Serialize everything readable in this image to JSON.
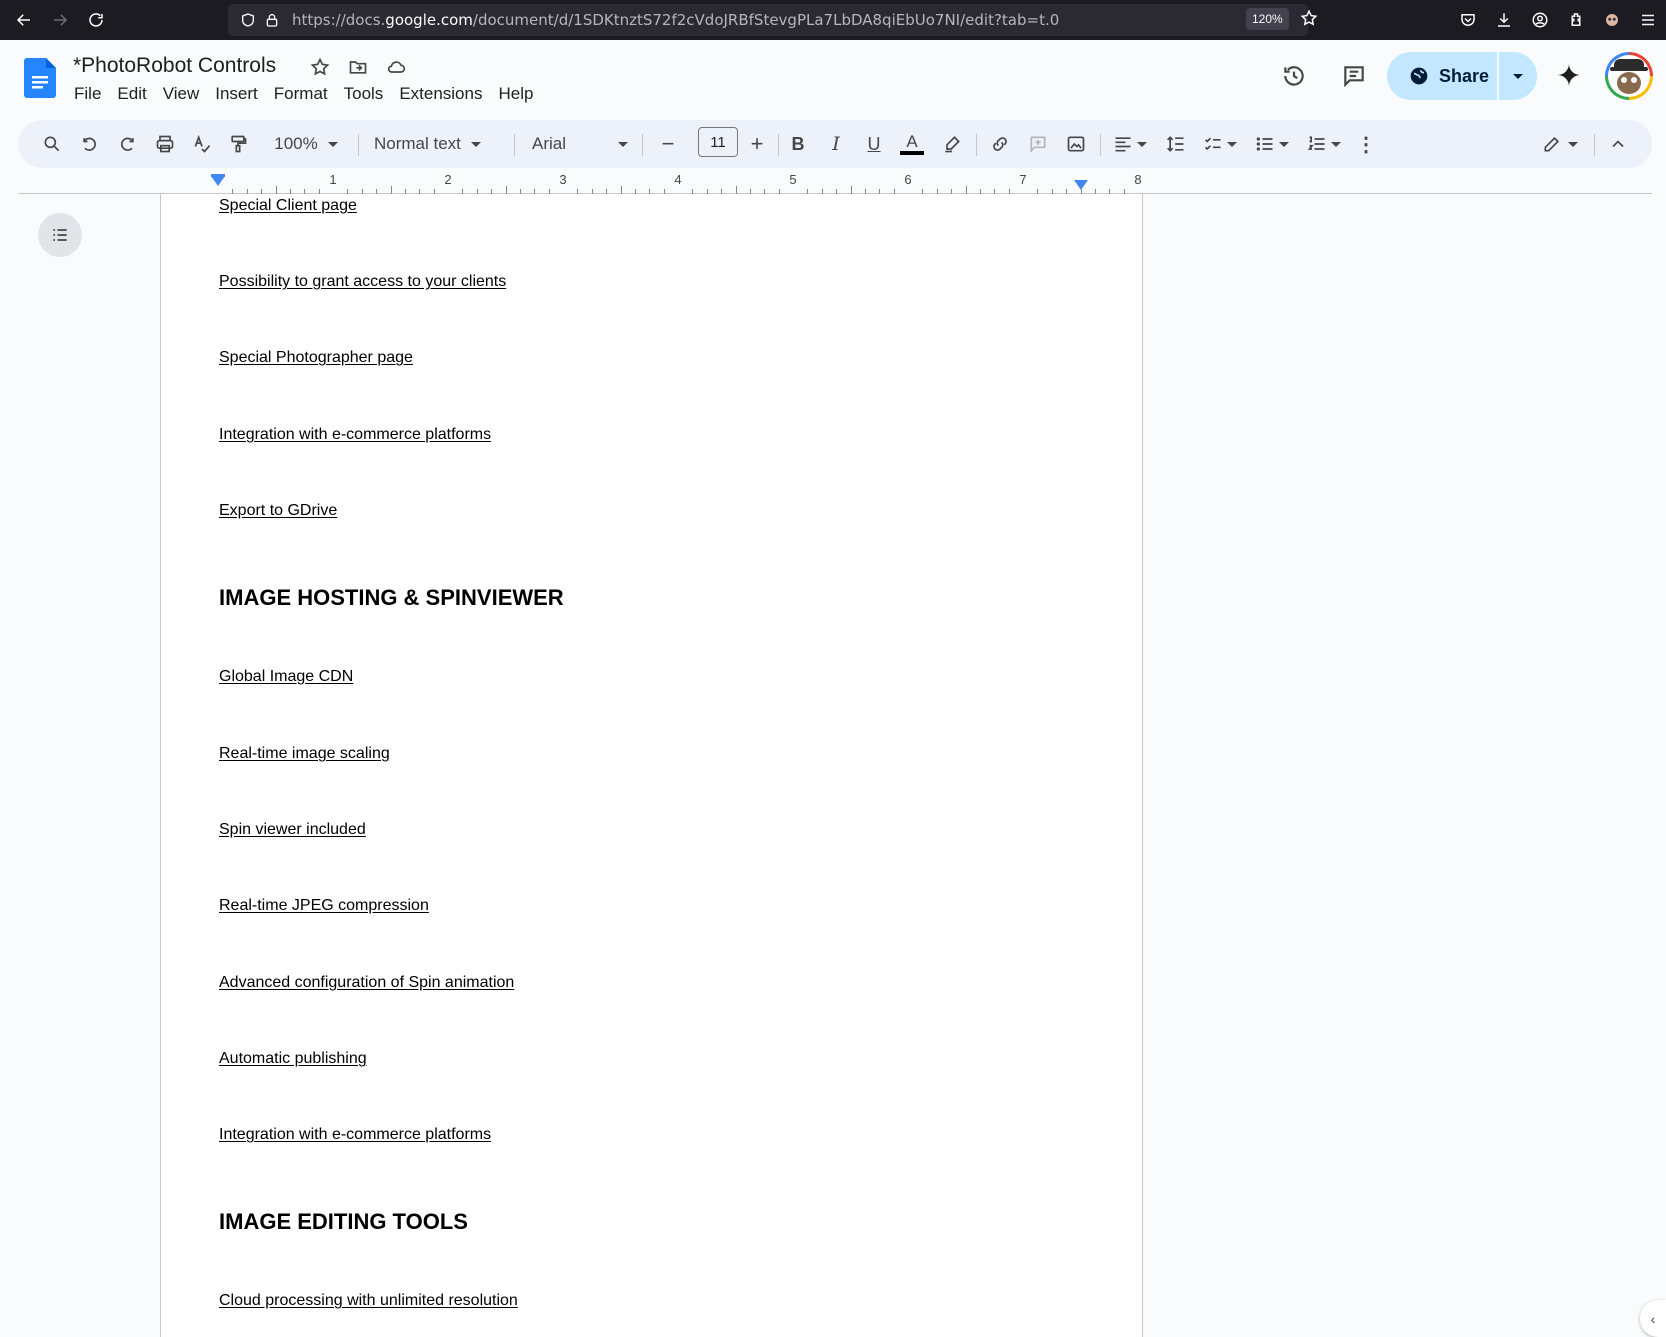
{
  "browser": {
    "url_prefix": "https://docs.",
    "url_domain": "google.com",
    "url_path": "/document/d/1SDKtnztS72f2cVdoJRBfStevgPLa7LbDA8qiEbUo7NI/edit?tab=t.0",
    "zoom": "120%"
  },
  "docs": {
    "title": "*PhotoRobot Controls",
    "menu": [
      "File",
      "Edit",
      "View",
      "Insert",
      "Format",
      "Tools",
      "Extensions",
      "Help"
    ],
    "share_label": "Share",
    "colors": {
      "accent": "#0b57d0",
      "share_bg": "#c2e7ff",
      "toolbar_bg": "#edf2fa"
    }
  },
  "toolbar": {
    "zoom": "100%",
    "style": "Normal text",
    "font": "Arial",
    "font_size": "11"
  },
  "ruler": {
    "numbers": [
      "1",
      "2",
      "3",
      "4",
      "5",
      "6",
      "7",
      "8"
    ]
  },
  "document": {
    "lines": [
      {
        "type": "link",
        "text": "Special Client page"
      },
      {
        "type": "link",
        "text": "Possibility to grant access to your clients"
      },
      {
        "type": "link",
        "text": "Special Photographer page"
      },
      {
        "type": "link",
        "text": "Integration with e-commerce platforms"
      },
      {
        "type": "link",
        "text": "Export to GDrive"
      },
      {
        "type": "heading",
        "text": "IMAGE HOSTING & SPINVIEWER"
      },
      {
        "type": "link",
        "text": "Global Image CDN"
      },
      {
        "type": "link",
        "text": "Real-time image scaling"
      },
      {
        "type": "link",
        "text": "Spin viewer included"
      },
      {
        "type": "link",
        "text": "Real-time JPEG compression"
      },
      {
        "type": "link",
        "text": "Advanced configuration of Spin animation"
      },
      {
        "type": "link",
        "text": "Automatic publishing"
      },
      {
        "type": "link",
        "text": "Integration with e-commerce platforms"
      },
      {
        "type": "heading",
        "text": "IMAGE EDITING TOOLS"
      },
      {
        "type": "link",
        "text": "Cloud processing with unlimited resolution"
      }
    ]
  }
}
